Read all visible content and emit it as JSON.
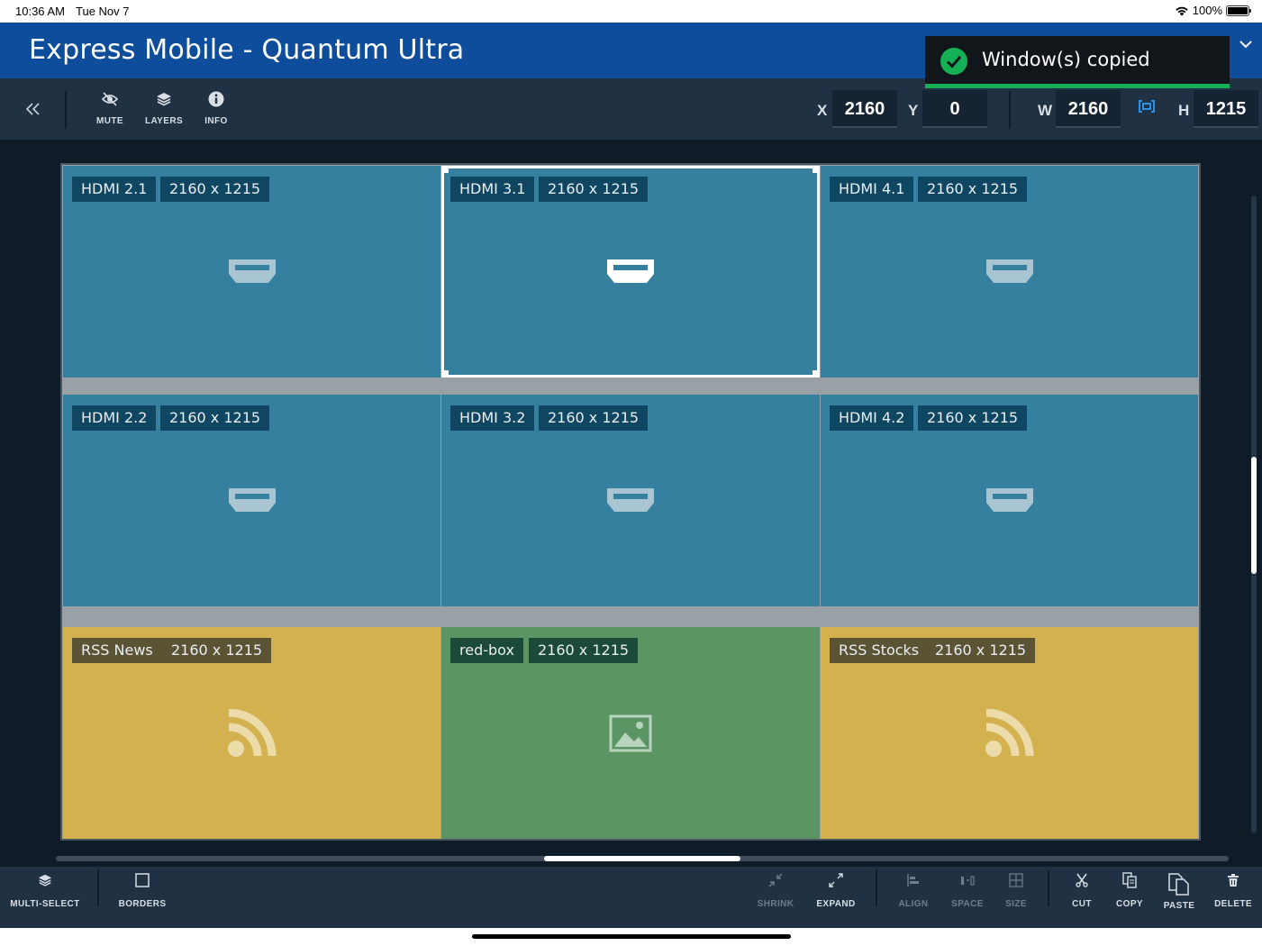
{
  "status_bar": {
    "time": "10:36 AM",
    "date": "Tue Nov 7",
    "battery": "100%",
    "wifi_icon": "wifi-icon"
  },
  "app": {
    "title": "Express Mobile - Quantum Ultra"
  },
  "toolbar": {
    "mute_label": "MUTE",
    "layers_label": "LAYERS",
    "info_label": "INFO",
    "x_label": "X",
    "x_value": "2160",
    "y_label": "Y",
    "y_value": "0",
    "w_label": "W",
    "w_value": "2160",
    "h_label": "H",
    "h_value": "1215"
  },
  "toast": {
    "message": "Window(s) copied",
    "accent_color": "#15b055"
  },
  "windows": [
    {
      "name": "HDMI 2.1",
      "size": "2160 x 1215",
      "kind": "hdmi"
    },
    {
      "name": "HDMI 3.1",
      "size": "2160 x 1215",
      "kind": "hdmi",
      "selected": true
    },
    {
      "name": "HDMI 4.1",
      "size": "2160 x 1215",
      "kind": "hdmi"
    },
    {
      "name": "HDMI 2.2",
      "size": "2160 x 1215",
      "kind": "hdmi"
    },
    {
      "name": "HDMI 3.2",
      "size": "2160 x 1215",
      "kind": "hdmi"
    },
    {
      "name": "HDMI 4.2",
      "size": "2160 x 1215",
      "kind": "hdmi"
    },
    {
      "name": "RSS News",
      "size": "2160 x 1215",
      "kind": "rss"
    },
    {
      "name": "red-box",
      "size": "2160 x 1215",
      "kind": "image"
    },
    {
      "name": "RSS Stocks",
      "size": "2160 x 1215",
      "kind": "rss"
    }
  ],
  "bottom_bar": {
    "multi_select": "MULTI-SELECT",
    "borders": "BORDERS",
    "shrink": "SHRINK",
    "expand": "EXPAND",
    "align": "ALIGN",
    "space": "SPACE",
    "size": "SIZE",
    "cut": "CUT",
    "copy": "COPY",
    "paste": "PASTE",
    "delete": "DELETE"
  },
  "colors": {
    "title_bar": "#0d4d9c",
    "hdmi_window": "#34809e",
    "rss_window": "#d3b14e",
    "image_window": "#5c9564"
  }
}
